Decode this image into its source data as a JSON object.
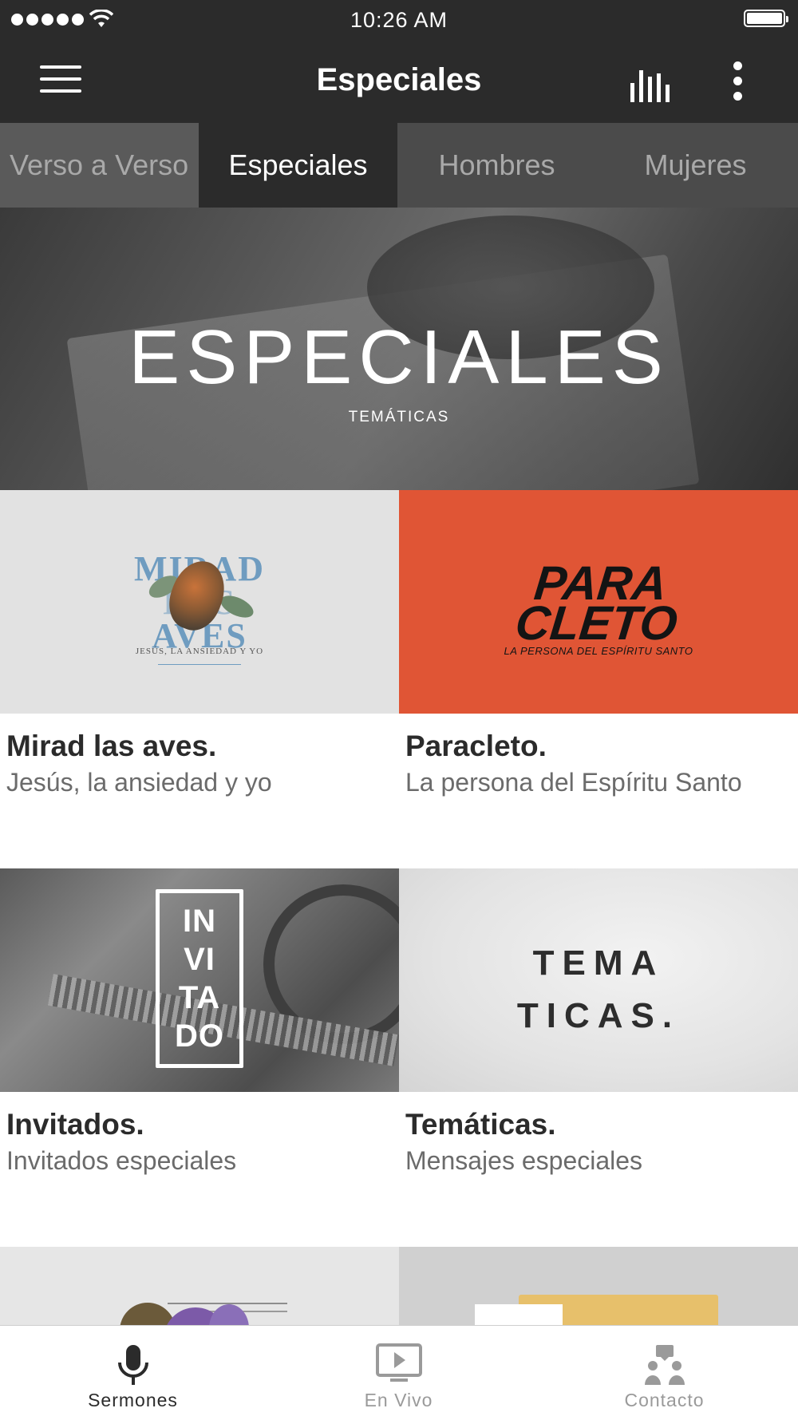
{
  "status_bar": {
    "time": "10:26 AM",
    "signal_dots": 5,
    "wifi_icon": "wifi-icon",
    "battery_icon": "battery-icon",
    "battery_level": 1.0
  },
  "app_bar": {
    "title": "Especiales",
    "menu_icon": "hamburger-menu-icon",
    "stats_icon": "bar-chart-icon",
    "more_icon": "more-vertical-icon"
  },
  "tabs": [
    {
      "label": "Verso a Verso",
      "active": false
    },
    {
      "label": "Especiales",
      "active": true
    },
    {
      "label": "Hombres",
      "active": false
    },
    {
      "label": "Mujeres",
      "active": false
    }
  ],
  "hero": {
    "title": "ESPECIALES",
    "subtitle": "TEMÁTICAS"
  },
  "cards": [
    {
      "title": "Mirad las aves.",
      "subtitle": "Jesús, la ansiedad y yo",
      "art_line1": "MIRAD",
      "art_line2": "LAS",
      "art_line3": "AVES",
      "art_caption": "JESÚS, LA ANSIEDAD Y YO"
    },
    {
      "title": "Paracleto.",
      "subtitle": "La persona del Espíritu Santo",
      "art_line1": "PARA",
      "art_line2": "CLETO",
      "art_caption": "LA PERSONA DEL ESPÍRITU SANTO"
    },
    {
      "title": "Invitados.",
      "subtitle": "Invitados especiales",
      "art_line1": "IN",
      "art_line2": "VI",
      "art_line3": "TA",
      "art_line4": "DO"
    },
    {
      "title": "Temáticas.",
      "subtitle": "Mensajes especiales",
      "art_line1": "TEMA",
      "art_line2": "TICAS."
    }
  ],
  "bottom_nav": [
    {
      "label": "Sermones",
      "icon": "microphone-icon",
      "active": true
    },
    {
      "label": "En Vivo",
      "icon": "tv-play-icon",
      "active": false
    },
    {
      "label": "Contacto",
      "icon": "people-icon",
      "active": false
    }
  ],
  "colors": {
    "app_bar": "#2b2b2b",
    "tab_bar": "#4b4b4b",
    "paracleto_accent": "#e05535",
    "aves_blue": "#6f9cc0",
    "active_nav": "#2b2b2b",
    "inactive_nav": "#9a9a9a"
  }
}
